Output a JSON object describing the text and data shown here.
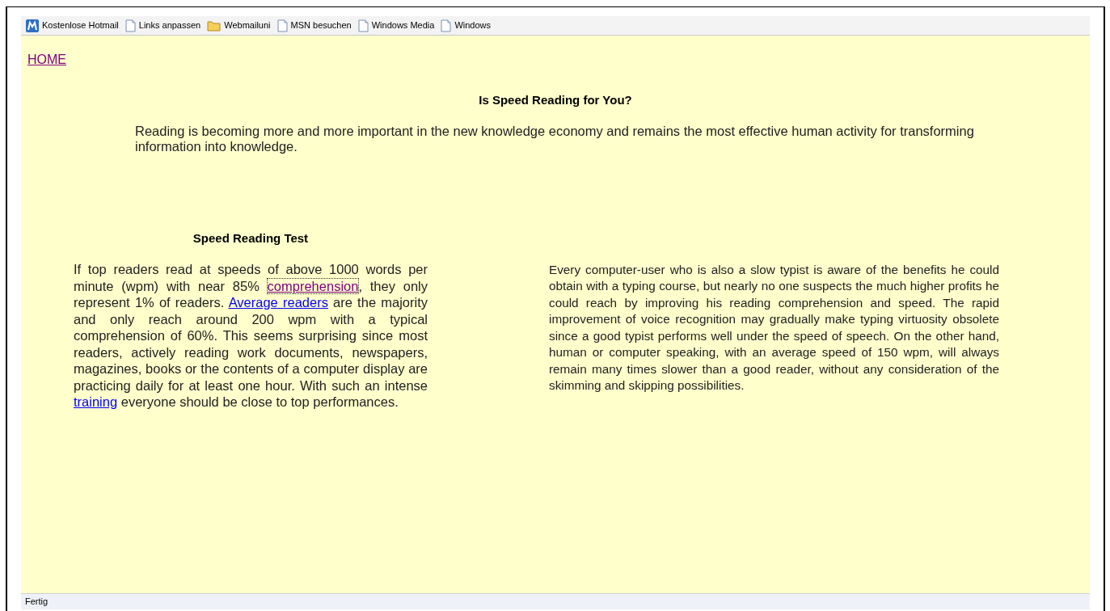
{
  "links_bar": [
    {
      "label": "Kostenlose Hotmail",
      "kind": "msn"
    },
    {
      "label": "Links anpassen",
      "kind": "page"
    },
    {
      "label": "Webmailuni",
      "kind": "folder"
    },
    {
      "label": "MSN besuchen",
      "kind": "page"
    },
    {
      "label": "Windows Media",
      "kind": "page"
    },
    {
      "label": "Windows",
      "kind": "page"
    }
  ],
  "home_link": {
    "text": "HOME",
    "visited": true
  },
  "title": "Is Speed Reading for You?",
  "intro": "Reading is becoming more and more important in the new knowledge economy and remains the most effective human activity for transforming information into knowledge.",
  "left_column": {
    "heading": "Speed Reading Test",
    "paragraph": [
      {
        "kind": "text",
        "text": "If top readers read at speeds of above 1000 words per minute (wpm) with near 85% "
      },
      {
        "kind": "link",
        "text": "comprehension",
        "visited": true,
        "focused": true
      },
      {
        "kind": "text",
        "text": ", they only represent 1% of readers. "
      },
      {
        "kind": "link",
        "text": "Average readers",
        "visited": false,
        "focused": false
      },
      {
        "kind": "text",
        "text": " are the majority and only reach around 200 wpm with a typical comprehension of 60%. This seems surprising since most readers, actively reading work documents, newspapers, magazines, books or the contents of a computer display are practicing daily for at least one hour. With such an intense "
      },
      {
        "kind": "link",
        "text": "training",
        "visited": false,
        "focused": false
      },
      {
        "kind": "text",
        "text": " everyone should be close to top performances."
      }
    ]
  },
  "right_column": {
    "paragraph": "Every computer-user who is also a slow typist is aware of the benefits he could obtain with a typing course, but nearly no one suspects the much higher profits he could reach by improving his reading comprehension and speed. The rapid improvement of voice recognition may gradually make typing virtuosity obsolete since a good typist performs well under the speed of speech. On the other hand, human or computer speaking, with an average speed of 150 wpm, will always remain many times slower than a good reader, without any consideration of the skimming and skipping possibilities."
  },
  "status_bar": "Fertig"
}
